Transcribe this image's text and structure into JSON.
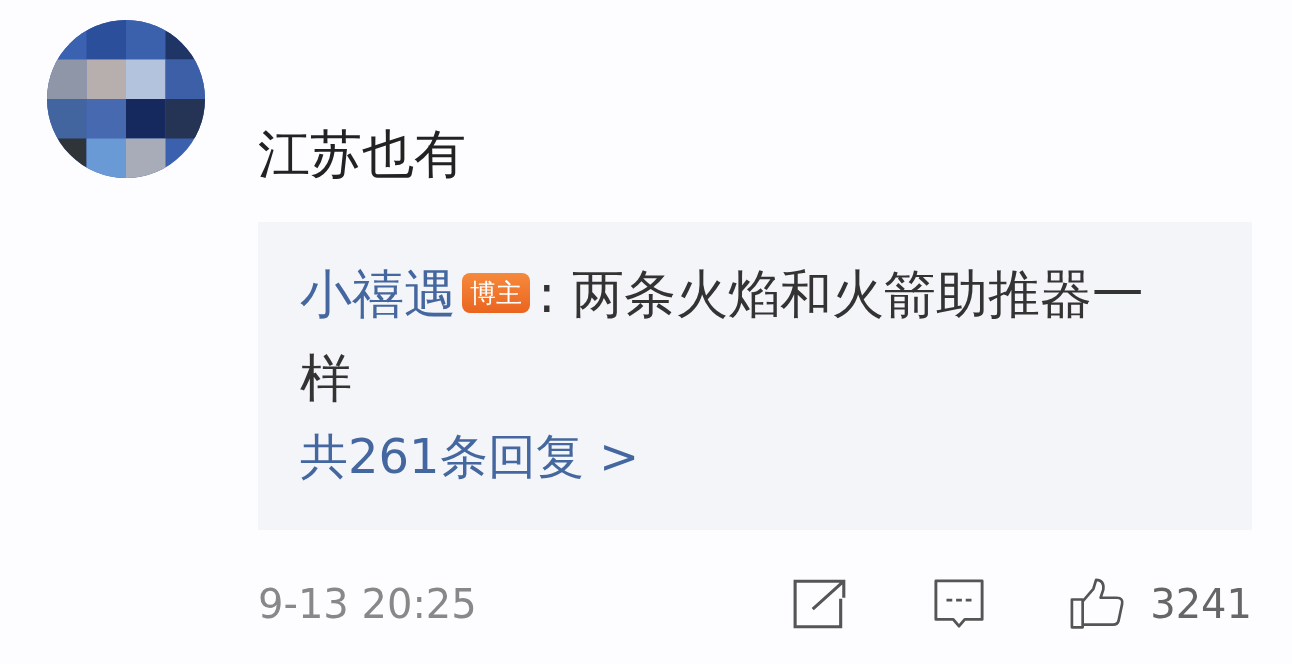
{
  "comment": {
    "text": "江苏也有",
    "reply_preview": {
      "author": "小禧遇",
      "badge": "博主",
      "text": ": 两条火焰和火箭助推器一样",
      "more": "共261条回复 >"
    },
    "time": "9-13 20:25",
    "actions": [
      {
        "kind": "share"
      },
      {
        "kind": "comment"
      },
      {
        "kind": "like",
        "count": "3241"
      }
    ]
  }
}
